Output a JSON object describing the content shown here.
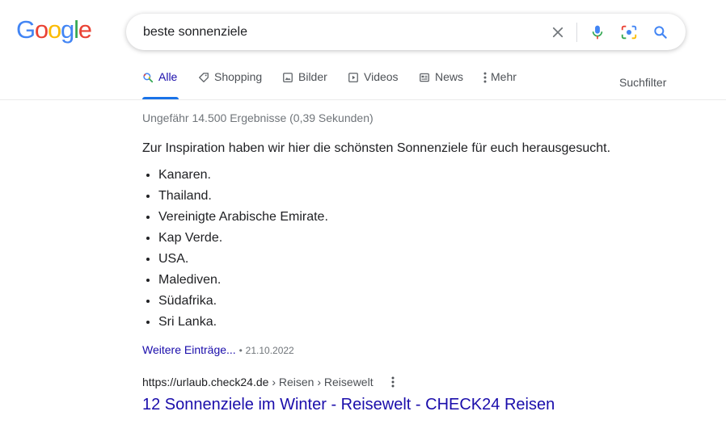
{
  "logo": {
    "letters": [
      "G",
      "o",
      "o",
      "g",
      "l",
      "e"
    ],
    "colors": [
      "#4285F4",
      "#EA4335",
      "#FBBC05",
      "#4285F4",
      "#34A853",
      "#EA4335"
    ]
  },
  "search": {
    "query": "beste sonnenziele",
    "icons": [
      "clear-icon",
      "microphone-icon",
      "camera-icon",
      "search-icon"
    ]
  },
  "tabs": [
    {
      "label": "Alle",
      "icon": "search-icon",
      "active": true
    },
    {
      "label": "Shopping",
      "icon": "tag-icon"
    },
    {
      "label": "Bilder",
      "icon": "image-icon"
    },
    {
      "label": "Videos",
      "icon": "video-icon"
    },
    {
      "label": "News",
      "icon": "news-icon"
    },
    {
      "label": "Mehr",
      "icon": "more-vert-icon"
    }
  ],
  "tools_label": "Suchfilter",
  "stats": "Ungefähr 14.500 Ergebnisse (0,39 Sekunden)",
  "featured": {
    "intro": "Zur Inspiration haben wir hier die schönsten Sonnenziele für euch herausgesucht.",
    "items": [
      "Kanaren.",
      "Thailand.",
      "Vereinigte Arabische Emirate.",
      "Kap Verde.",
      "USA.",
      "Malediven.",
      "Südafrika.",
      "Sri Lanka."
    ],
    "more_link": "Weitere Einträge...",
    "separator": "•",
    "date": "21.10.2022"
  },
  "result": {
    "url": "https://urlaub.check24.de",
    "breadcrumbs": " › Reisen › Reisewelt",
    "title": "12 Sonnenziele im Winter - Reisewelt - CHECK24 Reisen"
  },
  "colors": {
    "link": "#1a0dab",
    "accent": "#1a73e8",
    "muted": "#70757a",
    "text": "#202124"
  }
}
